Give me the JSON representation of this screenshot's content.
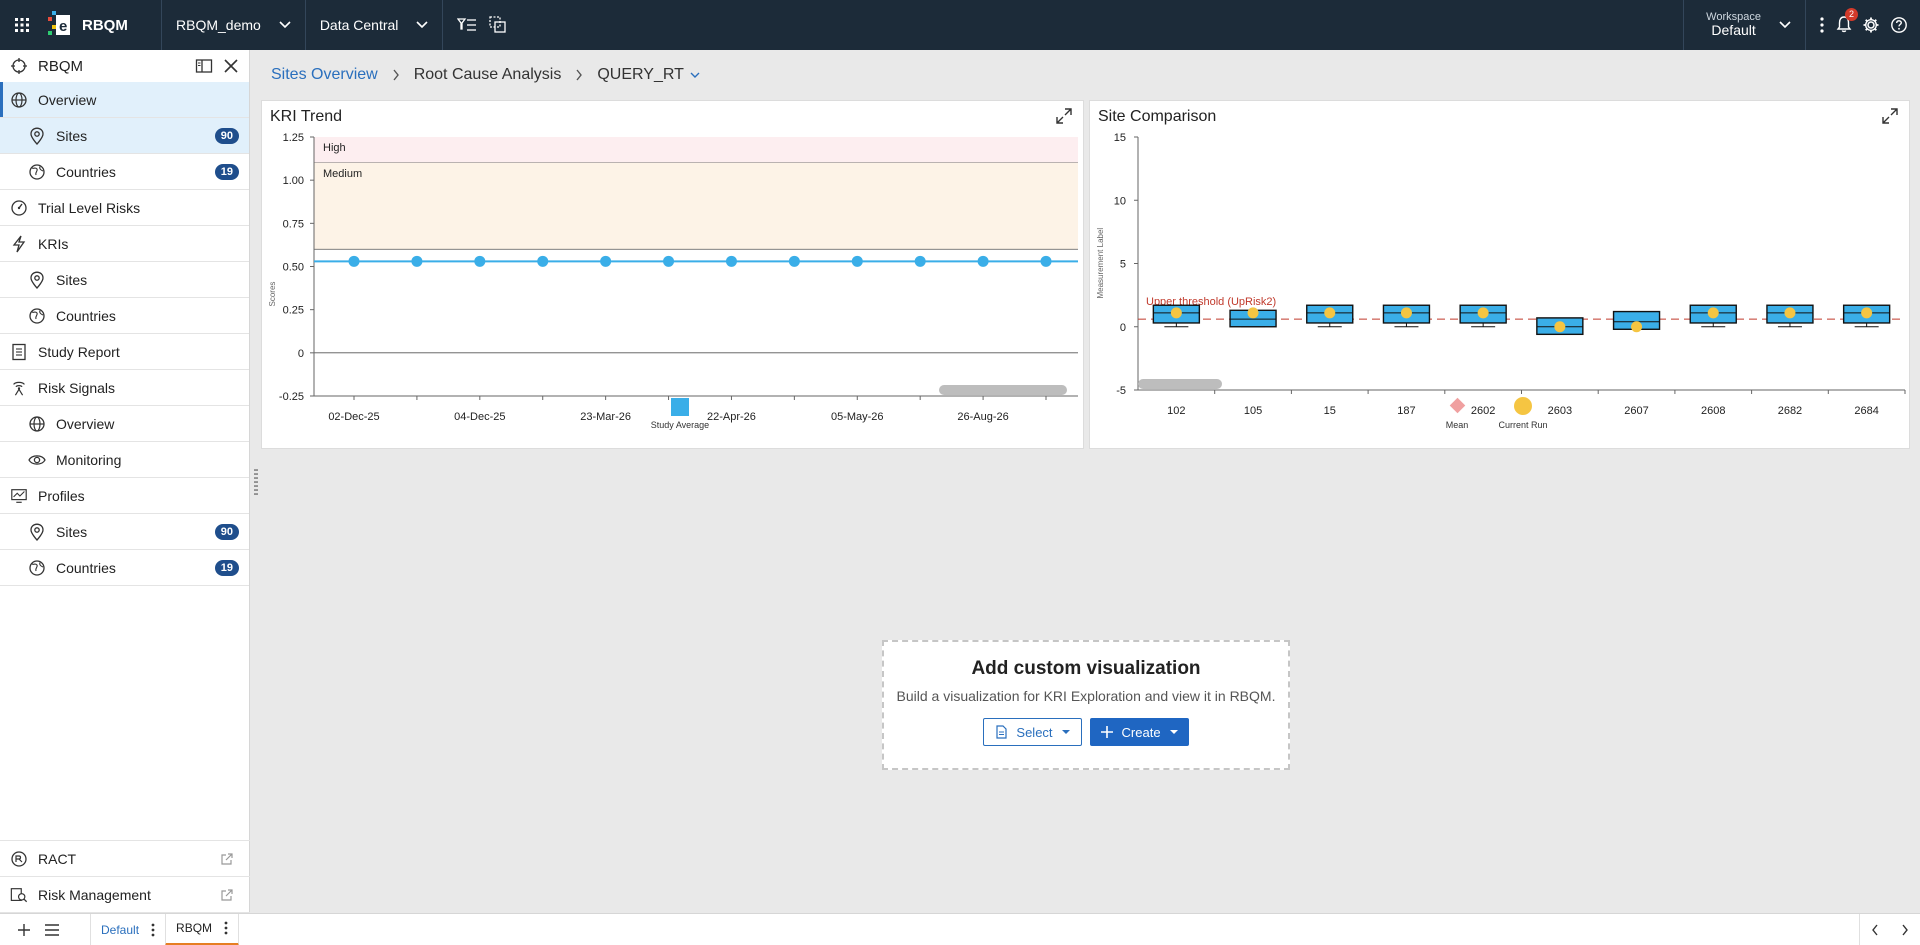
{
  "topbar": {
    "app_name": "RBQM",
    "study_dropdown": "RBQM_demo",
    "area_dropdown": "Data Central",
    "workspace_label": "Workspace",
    "workspace_value": "Default",
    "notifications_count": "2"
  },
  "sidebar": {
    "title": "RBQM",
    "items": [
      {
        "label": "Overview"
      },
      {
        "label": "Sites",
        "badge": "90"
      },
      {
        "label": "Countries",
        "badge": "19"
      },
      {
        "label": "Trial Level Risks"
      },
      {
        "label": "KRIs"
      },
      {
        "label": "Sites"
      },
      {
        "label": "Countries"
      },
      {
        "label": "Study Report"
      },
      {
        "label": "Risk Signals"
      },
      {
        "label": "Overview"
      },
      {
        "label": "Monitoring"
      },
      {
        "label": "Profiles"
      },
      {
        "label": "Sites",
        "badge": "90"
      },
      {
        "label": "Countries",
        "badge": "19"
      }
    ],
    "bottom_items": [
      {
        "label": "RACT"
      },
      {
        "label": "Risk Management"
      }
    ]
  },
  "breadcrumb": {
    "items": [
      "Sites Overview",
      "Root Cause Analysis",
      "QUERY_RT"
    ]
  },
  "kri_trend": {
    "title": "KRI Trend",
    "ylabel": "Scores",
    "band_high": "High",
    "band_medium": "Medium",
    "legend": "Study Average"
  },
  "site_comparison": {
    "title": "Site Comparison",
    "ylabel": "Measurement Label",
    "threshold_label": "Upper threshold (UpRisk2)",
    "legend_mean": "Mean",
    "legend_current": "Current Run"
  },
  "chart_data": [
    {
      "type": "line",
      "title": "KRI Trend",
      "ylabel": "Scores",
      "ylim": [
        -0.25,
        1.25
      ],
      "yticks": [
        "1.25",
        "1.00",
        "0.75",
        "0.50",
        "0.25",
        "0",
        "-0.25"
      ],
      "x": [
        "02-Dec-25",
        "",
        "04-Dec-25",
        "",
        "23-Mar-26",
        "",
        "22-Apr-26",
        "",
        "05-May-26",
        "",
        "26-Aug-26",
        ""
      ],
      "bands": [
        {
          "label": "High",
          "from": 1.1,
          "to": 1.25,
          "color": "#fdeef0"
        },
        {
          "label": "Medium",
          "from": 0.6,
          "to": 1.1,
          "color": "#fdf3e7"
        }
      ],
      "series": [
        {
          "name": "Study Average",
          "values": [
            0.53,
            0.53,
            0.53,
            0.53,
            0.53,
            0.53,
            0.53,
            0.53,
            0.53,
            0.53,
            0.53,
            0.53
          ],
          "color": "#3aaee8"
        }
      ],
      "grid": false,
      "legend": "bottom"
    },
    {
      "type": "box",
      "title": "Site Comparison",
      "ylabel": "Measurement Label",
      "ylim": [
        -5,
        15
      ],
      "yticks": [
        "15",
        "10",
        "5",
        "0",
        "-5"
      ],
      "categories": [
        "102",
        "105",
        "15",
        "187",
        "2602",
        "2603",
        "2607",
        "2608",
        "2682",
        "2684"
      ],
      "boxes": [
        {
          "min": 0,
          "q1": 0.3,
          "median": 1.1,
          "q3": 1.7,
          "max": 1.7,
          "current": 1.1
        },
        {
          "min": 0,
          "q1": 0,
          "median": 0.6,
          "q3": 1.3,
          "max": 1.3,
          "current": 1.1
        },
        {
          "min": 0,
          "q1": 0.3,
          "median": 1.1,
          "q3": 1.7,
          "max": 1.7,
          "current": 1.1
        },
        {
          "min": 0,
          "q1": 0.3,
          "median": 1.1,
          "q3": 1.7,
          "max": 1.7,
          "current": 1.1
        },
        {
          "min": 0,
          "q1": 0.3,
          "median": 1.1,
          "q3": 1.7,
          "max": 1.7,
          "current": 1.1
        },
        {
          "min": -0.6,
          "q1": -0.6,
          "median": 0,
          "q3": 0.7,
          "max": 0.7,
          "current": 0
        },
        {
          "min": -0.2,
          "q1": -0.2,
          "median": 0.4,
          "q3": 1.2,
          "max": 1.2,
          "current": 0
        },
        {
          "min": 0,
          "q1": 0.3,
          "median": 1.1,
          "q3": 1.7,
          "max": 1.7,
          "current": 1.1
        },
        {
          "min": 0,
          "q1": 0.3,
          "median": 1.1,
          "q3": 1.7,
          "max": 1.7,
          "current": 1.1
        },
        {
          "min": 0,
          "q1": 0.3,
          "median": 1.1,
          "q3": 1.7,
          "max": 1.7,
          "current": 1.1
        }
      ],
      "threshold": {
        "label": "Upper threshold (UpRisk2)",
        "value": 0.6,
        "color": "#c0392b"
      },
      "colors": {
        "box": "#3aaee8",
        "current": "#f5c542",
        "mean": "#f0a0a0"
      },
      "legend": "bottom"
    }
  ],
  "custom_viz": {
    "title": "Add custom visualization",
    "description": "Build a visualization for KRI Exploration and view it in RBQM.",
    "select_label": "Select",
    "create_label": "Create"
  },
  "bottombar": {
    "tabs": [
      "Default",
      "RBQM"
    ]
  },
  "colors": {
    "topbar": "#1c2b39",
    "accent": "#2a6fbd",
    "badge": "#1f4e8c",
    "active_tab_underline": "#e67e22"
  }
}
